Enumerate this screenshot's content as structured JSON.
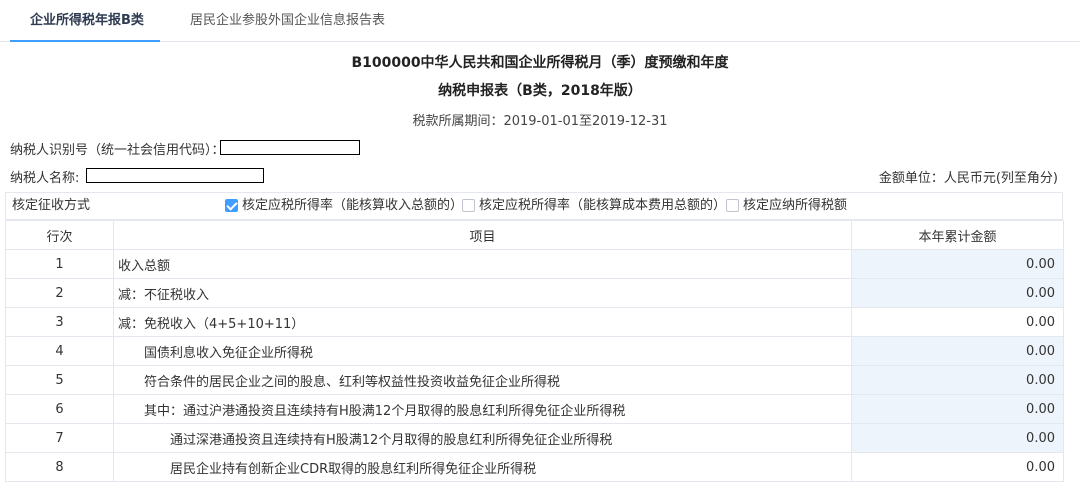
{
  "tabs": [
    {
      "label": "企业所得税年报B类"
    },
    {
      "label": "居民企业参股外国企业信息报告表"
    }
  ],
  "form": {
    "title_line1": "B100000中华人民共和国企业所得税月（季）度预缴和年度",
    "title_line2": "纳税申报表（B类，2018年版）",
    "period": "税款所属期间：2019-01-01至2019-12-31"
  },
  "taxpayer": {
    "id_label": "纳税人识别号（统一社会信用代码）：",
    "name_label": "纳税人名称:",
    "unit": "金额单位：人民币元(列至角分)"
  },
  "method": {
    "label": "核定征收方式",
    "options": [
      {
        "label": "核定应税所得率（能核算收入总额的）",
        "checked": true
      },
      {
        "label": "核定应税所得率（能核算成本费用总额的）",
        "checked": false
      },
      {
        "label": "核定应纳所得税额",
        "checked": false
      }
    ]
  },
  "table": {
    "headers": {
      "no": "行次",
      "item": "项目",
      "amount": "本年累计金额"
    },
    "rows": [
      {
        "no": "1",
        "item": "收入总额",
        "amount": "0.00",
        "editable": true,
        "indent": 0
      },
      {
        "no": "2",
        "item": "减：不征税收入",
        "amount": "0.00",
        "editable": true,
        "indent": 0
      },
      {
        "no": "3",
        "item": "减：免税收入（4+5+10+11）",
        "amount": "0.00",
        "editable": false,
        "indent": 0
      },
      {
        "no": "4",
        "item": "国债利息收入免征企业所得税",
        "amount": "0.00",
        "editable": true,
        "indent": 1
      },
      {
        "no": "5",
        "item": "符合条件的居民企业之间的股息、红利等权益性投资收益免征企业所得税",
        "amount": "0.00",
        "editable": true,
        "indent": 1
      },
      {
        "no": "6",
        "item": "其中：通过沪港通投资且连续持有H股满12个月取得的股息红利所得免征企业所得税",
        "amount": "0.00",
        "editable": true,
        "indent": 1
      },
      {
        "no": "7",
        "item": "通过深港通投资且连续持有H股满12个月取得的股息红利所得免征企业所得税",
        "amount": "0.00",
        "editable": true,
        "indent": 2
      },
      {
        "no": "8",
        "item": "居民企业持有创新企业CDR取得的股息红利所得免征企业所得税",
        "amount": "0.00",
        "editable": false,
        "indent": 2
      }
    ]
  }
}
